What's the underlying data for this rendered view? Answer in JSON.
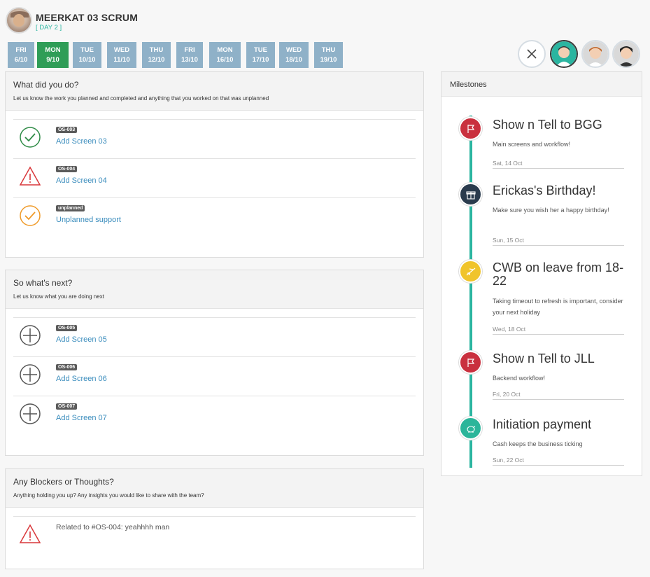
{
  "header": {
    "title": "MEERKAT 03 SCRUM",
    "day": "[ DAY 2 ]"
  },
  "days": [
    {
      "d": "FRI",
      "date": "6/10",
      "active": false
    },
    {
      "d": "MON",
      "date": "9/10",
      "active": true
    },
    {
      "d": "TUE",
      "date": "10/10",
      "active": false
    },
    {
      "d": "WED",
      "date": "11/10",
      "active": false
    },
    {
      "d": "THU",
      "date": "12/10",
      "active": false
    },
    {
      "d": "FRI",
      "date": "13/10",
      "active": false
    },
    {
      "d": "MON",
      "date": "16/10",
      "active": false
    },
    {
      "d": "TUE",
      "date": "17/10",
      "active": false
    },
    {
      "d": "WED",
      "date": "18/10",
      "active": false
    },
    {
      "d": "THU",
      "date": "19/10",
      "active": false
    }
  ],
  "done": {
    "title": "What did you do?",
    "subtitle": "Let us know the work you planned and completed and anything that you worked on that was unplanned",
    "items": [
      {
        "status": "check-green",
        "tag": "OS-003",
        "label": "Add Screen 03"
      },
      {
        "status": "warning",
        "tag": "OS-004",
        "label": "Add Screen 04"
      },
      {
        "status": "check-orange",
        "tag": "unplanned",
        "label": "Unplanned support"
      }
    ]
  },
  "next": {
    "title": "So what's next?",
    "subtitle": "Let us know what you are doing next",
    "items": [
      {
        "tag": "OS-005",
        "label": "Add Screen 05"
      },
      {
        "tag": "OS-006",
        "label": "Add Screen 06"
      },
      {
        "tag": "OS-007",
        "label": "Add Screen 07"
      }
    ]
  },
  "blockers": {
    "title": "Any Blockers or Thoughts?",
    "subtitle": "Anything holding you up? Any insights you would like to share with the team?",
    "items": [
      {
        "note": "Related to #OS-004: yeahhhh man"
      }
    ]
  },
  "milestones": {
    "title": "Milestones",
    "items": [
      {
        "icon": "flag-icon",
        "color": "#c9303e",
        "title": "Show n Tell to BGG",
        "desc": "Main screens and workflow!",
        "date": "Sat, 14 Oct"
      },
      {
        "icon": "gift-icon",
        "color": "#2a3b4d",
        "title": "Erickas's Birthday!",
        "desc": "Make sure you wish her a happy birthday!",
        "date": "Sun, 15 Oct"
      },
      {
        "icon": "plane-icon",
        "color": "#f0c42b",
        "title": "CWB on leave from 18-22",
        "desc": "Taking timeout to refresh is important, consider your next holiday",
        "date": "Wed, 18 Oct"
      },
      {
        "icon": "flag-icon",
        "color": "#c9303e",
        "title": "Show n Tell to JLL",
        "desc": "Backend workflow!",
        "date": "Fri, 20 Oct"
      },
      {
        "icon": "piggy-bank-icon",
        "color": "#2bb59a",
        "title": "Initiation payment",
        "desc": "Cash keeps the business ticking",
        "date": "Sun, 22 Oct"
      }
    ]
  }
}
